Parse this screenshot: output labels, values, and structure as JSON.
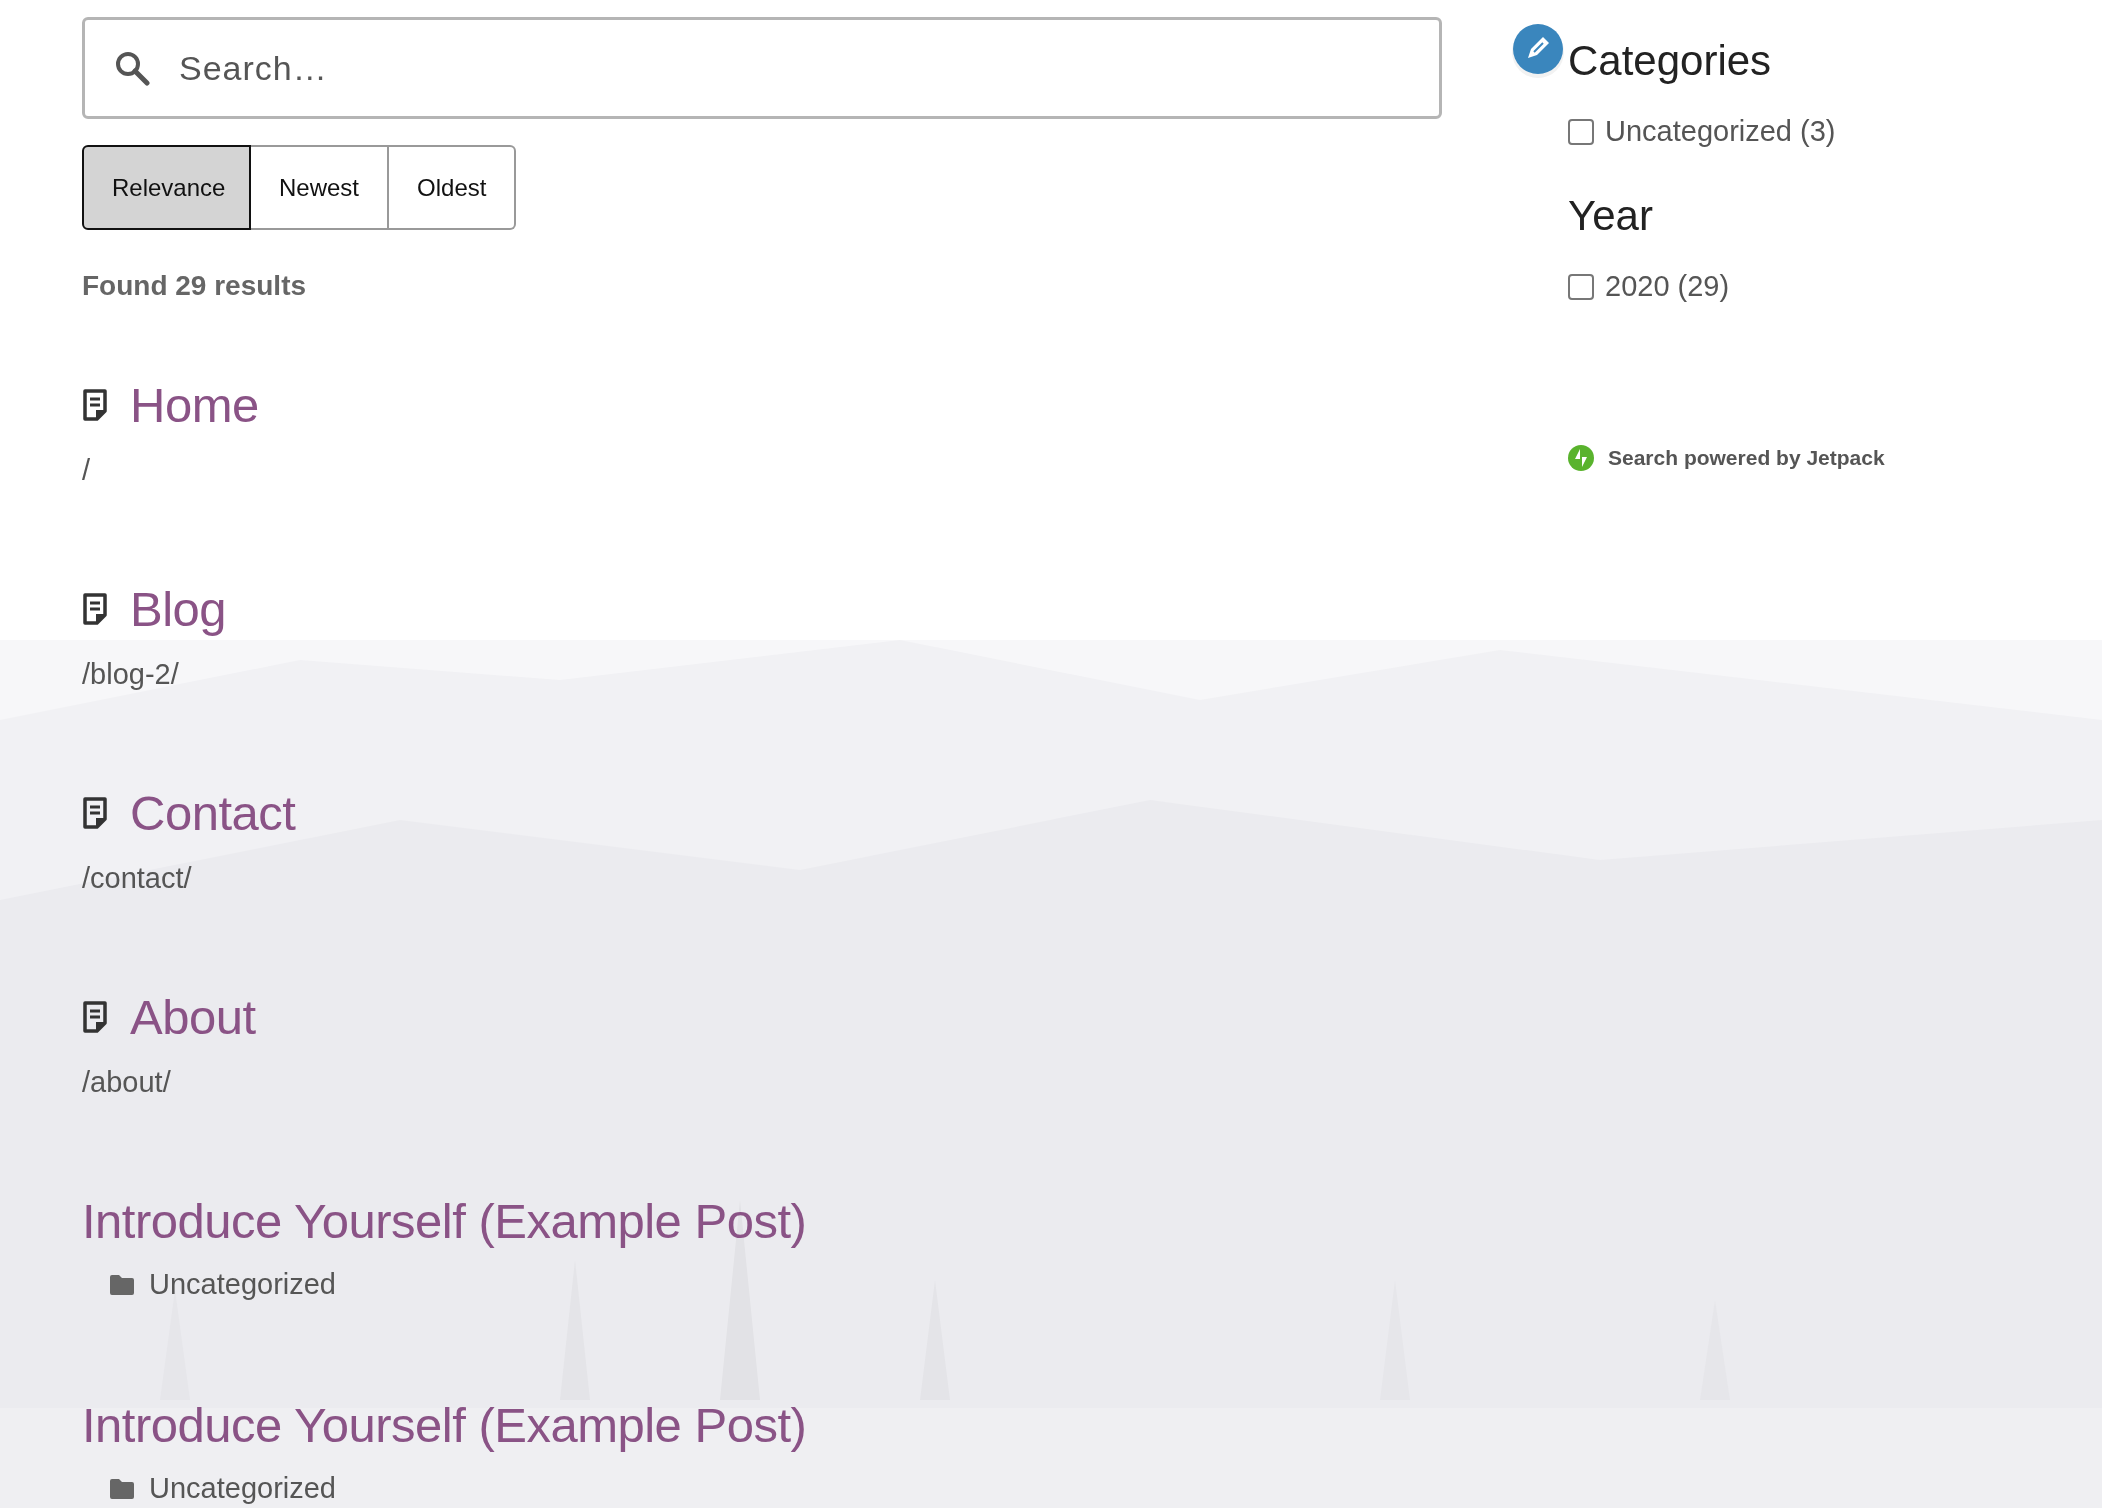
{
  "search": {
    "placeholder": "Search…"
  },
  "sort_options": [
    {
      "label": "Relevance",
      "selected": true
    },
    {
      "label": "Newest",
      "selected": false
    },
    {
      "label": "Oldest",
      "selected": false
    }
  ],
  "result_count": "Found 29 results",
  "results": [
    {
      "kind": "page",
      "title": "Home",
      "path": "/"
    },
    {
      "kind": "page",
      "title": "Blog",
      "path": "/blog-2/"
    },
    {
      "kind": "page",
      "title": "Contact",
      "path": "/contact/"
    },
    {
      "kind": "page",
      "title": "About",
      "path": "/about/"
    },
    {
      "kind": "post",
      "title": "Introduce Yourself (Example Post)",
      "category": "Uncategorized"
    },
    {
      "kind": "post",
      "title": "Introduce Yourself (Example Post)",
      "category": "Uncategorized"
    }
  ],
  "filters": [
    {
      "heading": "Categories",
      "options": [
        {
          "label": "Uncategorized (3)",
          "checked": false
        }
      ]
    },
    {
      "heading": "Year",
      "options": [
        {
          "label": "2020 (29)",
          "checked": false
        }
      ]
    }
  ],
  "footer": "Search powered by Jetpack"
}
